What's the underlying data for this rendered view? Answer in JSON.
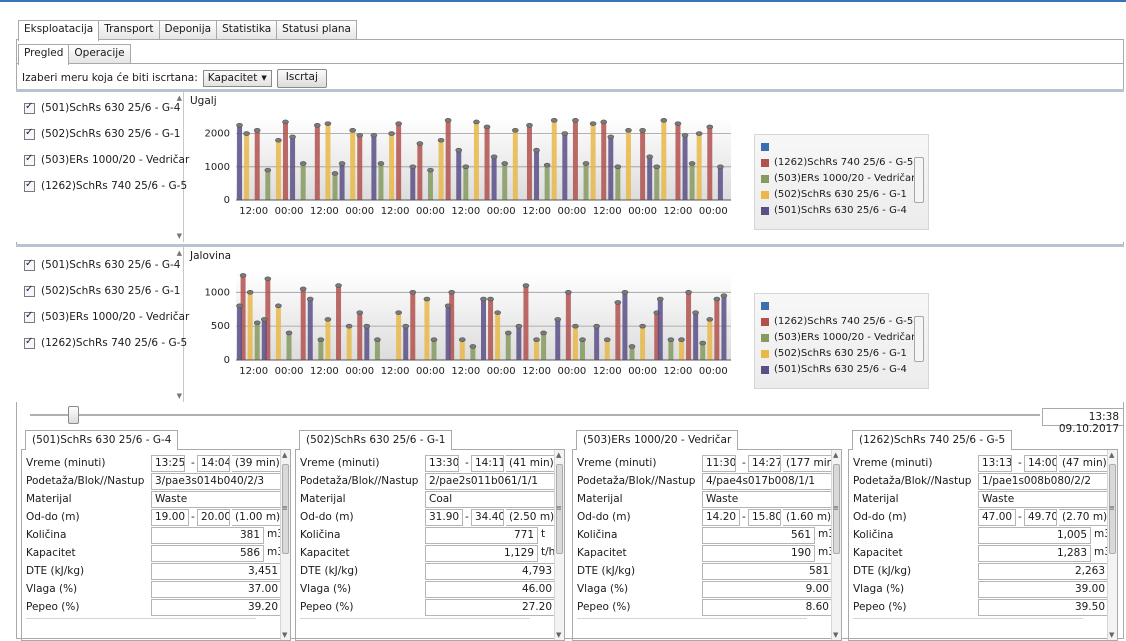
{
  "tabs": [
    "Eksploatacija",
    "Transport",
    "Deponija",
    "Statistika",
    "Statusi plana"
  ],
  "subtabs": [
    "Pregled",
    "Operacije"
  ],
  "toolbar": {
    "label": "Izaberi meru koja će biti iscrtana:",
    "measure": "Kapacitet",
    "draw_button": "Iscrtaj"
  },
  "checklist": [
    "(501)SchRs 630 25/6 - G-4",
    "(502)SchRs 630 25/6 - G-1",
    "(503)ERs 1000/20 - Vedričar",
    "(1262)SchRs 740 25/6 - G-5"
  ],
  "colors": {
    "s1262": "#b0514d",
    "s503": "#869a60",
    "s502": "#e8b94a",
    "s501": "#5a4f86",
    "accent": "#3a74b8"
  },
  "chart_data": [
    {
      "type": "bar",
      "title": "Ugalj",
      "xticks": [
        "12:00",
        "00:00",
        "12:00",
        "00:00",
        "12:00",
        "00:00",
        "12:00",
        "00:00",
        "12:00",
        "00:00",
        "12:00",
        "00:00",
        "12:00",
        "00:00"
      ],
      "yticks": [
        0,
        1000,
        2000
      ],
      "ylim": [
        0,
        2500
      ],
      "legend": [
        "(1262)SchRs 740 25/6 - G-5",
        "(503)ERs 1000/20 - Vedričar",
        "(502)SchRs 630 25/6 - G-1",
        "(501)SchRs 630 25/6 - G-4"
      ],
      "legend_placement": "right",
      "series": [
        {
          "name": "(1262)SchRs 740 25/6 - G-5",
          "x": [
            0.6,
            1.4,
            2.3,
            3.5,
            4.6,
            5.2,
            6.0,
            7.1,
            8.3,
            9.6,
            10.4,
            11.5,
            12.5,
            13.4
          ],
          "values": [
            2100,
            2350,
            2250,
            1950,
            2300,
            1700,
            2400,
            2200,
            2250,
            2400,
            2350,
            2100,
            2300,
            2200
          ]
        },
        {
          "name": "(503)ERs 1000/20 - Vedričar",
          "x": [
            0.9,
            1.9,
            2.8,
            4.1,
            5.5,
            6.5,
            7.6,
            8.8,
            9.9,
            10.8,
            11.9,
            12.9
          ],
          "values": [
            900,
            1100,
            800,
            1100,
            900,
            1000,
            1100,
            1050,
            1100,
            1000,
            1000,
            1100
          ]
        },
        {
          "name": "(502)SchRs 630 25/6 - G-1",
          "x": [
            0.3,
            1.2,
            2.6,
            3.3,
            4.4,
            5.8,
            6.8,
            7.9,
            9.0,
            10.1,
            11.1,
            12.1,
            13.1
          ],
          "values": [
            2000,
            1800,
            2300,
            2100,
            2000,
            1800,
            2350,
            2100,
            2400,
            2300,
            2100,
            2400,
            2000
          ]
        },
        {
          "name": "(501)SchRs 630 25/6 - G-4",
          "x": [
            0.1,
            1.6,
            3.0,
            3.9,
            5.0,
            6.3,
            7.3,
            8.5,
            9.3,
            10.6,
            11.7,
            12.7,
            13.7
          ],
          "values": [
            2250,
            1900,
            1100,
            1950,
            1000,
            1500,
            1300,
            1500,
            2000,
            1900,
            1300,
            1950,
            1000
          ]
        }
      ]
    },
    {
      "type": "bar",
      "title": "Jalovina",
      "xticks": [
        "12:00",
        "00:00",
        "12:00",
        "00:00",
        "12:00",
        "00:00",
        "12:00",
        "00:00",
        "12:00",
        "00:00",
        "12:00",
        "00:00",
        "12:00",
        "00:00"
      ],
      "yticks": [
        0,
        500,
        1000
      ],
      "ylim": [
        0,
        1300
      ],
      "legend": [
        "(1262)SchRs 740 25/6 - G-5",
        "(503)ERs 1000/20 - Vedričar",
        "(502)SchRs 630 25/6 - G-1",
        "(501)SchRs 630 25/6 - G-4"
      ],
      "legend_placement": "right",
      "series": [
        {
          "name": "(1262)SchRs 740 25/6 - G-5",
          "x": [
            0.2,
            0.9,
            1.9,
            2.9,
            3.5,
            5.0,
            6.1,
            7.2,
            8.2,
            9.4,
            10.8,
            11.9,
            12.8,
            13.6
          ],
          "values": [
            1250,
            1200,
            1050,
            1100,
            700,
            1000,
            1000,
            900,
            1100,
            1000,
            850,
            700,
            1000,
            900
          ]
        },
        {
          "name": "(503)ERs 1000/20 - Vedričar",
          "x": [
            0.6,
            1.5,
            2.4,
            4.0,
            5.6,
            6.7,
            7.7,
            8.7,
            9.8,
            11.2,
            12.3,
            13.2
          ],
          "values": [
            550,
            400,
            300,
            300,
            300,
            200,
            400,
            400,
            300,
            200,
            300,
            250
          ]
        },
        {
          "name": "(502)SchRs 630 25/6 - G-1",
          "x": [
            0.4,
            1.2,
            2.6,
            3.2,
            4.6,
            5.4,
            6.4,
            7.4,
            8.5,
            9.6,
            10.5,
            11.5,
            12.6,
            13.4
          ],
          "values": [
            1000,
            800,
            600,
            500,
            700,
            900,
            300,
            700,
            300,
            500,
            300,
            500,
            300,
            600
          ]
        },
        {
          "name": "(501)SchRs 630 25/6 - G-4",
          "x": [
            0.1,
            0.8,
            2.1,
            3.7,
            4.8,
            6.0,
            7.0,
            8.0,
            9.1,
            10.2,
            11.0,
            12.0,
            13.0,
            13.8
          ],
          "values": [
            800,
            600,
            900,
            500,
            500,
            800,
            900,
            500,
            600,
            500,
            1000,
            900,
            700,
            950
          ]
        }
      ]
    }
  ],
  "timestamp": "13:38 09.10.2017",
  "row_labels": [
    "Vreme (minuti)",
    "Podetaža/Blok//Nastup",
    "Materijal",
    "Od-do (m)",
    "Količina",
    "Kapacitet",
    "DTE (kJ/kg)",
    "Vlaga (%)",
    "Pepeo (%)"
  ],
  "panels": [
    {
      "title": "(501)SchRs 630 25/6 - G-4",
      "time_from": "13:25",
      "time_to": "14:04",
      "duration": "(39 min)",
      "block": "3/pae3s014b040/2/3",
      "material": "Waste",
      "depth_from": "19.00",
      "depth_to": "20.00",
      "depth_len": "(1.00 m)",
      "qty": "381",
      "qty_unit": "m3",
      "cap": "586",
      "cap_unit": "m3/h",
      "dte": "3,451",
      "moist": "37.00",
      "ash": "39.20"
    },
    {
      "title": "(502)SchRs 630 25/6 - G-1",
      "time_from": "13:30",
      "time_to": "14:11",
      "duration": "(41 min)",
      "block": "2/pae2s011b061/1/1",
      "material": "Coal",
      "depth_from": "31.90",
      "depth_to": "34.40",
      "depth_len": "(2.50 m)",
      "qty": "771",
      "qty_unit": "t",
      "cap": "1,129",
      "cap_unit": "t/h",
      "dte": "4,793",
      "moist": "46.00",
      "ash": "27.20"
    },
    {
      "title": "(503)ERs 1000/20 - Vedričar",
      "time_from": "11:30",
      "time_to": "14:27",
      "duration": "(177 min)",
      "block": "4/pae4s017b008/1/1",
      "material": "Waste",
      "depth_from": "14.20",
      "depth_to": "15.80",
      "depth_len": "(1.60 m)",
      "qty": "561",
      "qty_unit": "m3",
      "cap": "190",
      "cap_unit": "m3/h",
      "dte": "581",
      "moist": "9.00",
      "ash": "8.60"
    },
    {
      "title": "(1262)SchRs 740 25/6 - G-5",
      "time_from": "13:13",
      "time_to": "14:00",
      "duration": "(47 min)",
      "block": "1/pae1s008b080/2/2",
      "material": "Waste",
      "depth_from": "47.00",
      "depth_to": "49.70",
      "depth_len": "(2.70 m)",
      "qty": "1,005",
      "qty_unit": "m3",
      "cap": "1,283",
      "cap_unit": "m3/h",
      "dte": "2,263",
      "moist": "39.00",
      "ash": "39.50"
    }
  ]
}
